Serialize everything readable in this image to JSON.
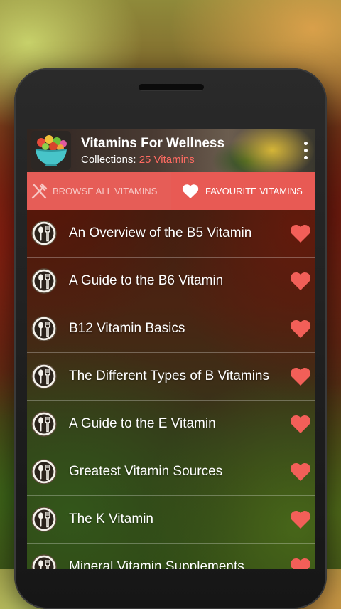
{
  "app": {
    "title": "Vitamins For Wellness",
    "subtitle_prefix": "Collections: ",
    "subtitle_count": "25 Vitamins"
  },
  "tabs": {
    "browse_label": "BROWSE ALL VITAMINS",
    "favourite_label": "FAVOURITE VITAMINS",
    "active": "favourite"
  },
  "items": [
    {
      "label": "An Overview of the B5 Vitamin"
    },
    {
      "label": "A Guide to the B6 Vitamin"
    },
    {
      "label": "B12 Vitamin Basics"
    },
    {
      "label": "The Different Types of B Vitamins"
    },
    {
      "label": "A Guide to the E Vitamin"
    },
    {
      "label": "Greatest Vitamin Sources"
    },
    {
      "label": "The K Vitamin"
    },
    {
      "label": "Mineral Vitamin Supplements"
    }
  ],
  "icons": {
    "menu": "more-vert-icon",
    "browse": "fork-knife-icon",
    "favourite": "heart-icon",
    "row": "utensils-icon",
    "row_action": "heart-icon"
  },
  "colors": {
    "accent": "#e85a54",
    "count": "#ff6b62",
    "heart": "#f25f58"
  }
}
